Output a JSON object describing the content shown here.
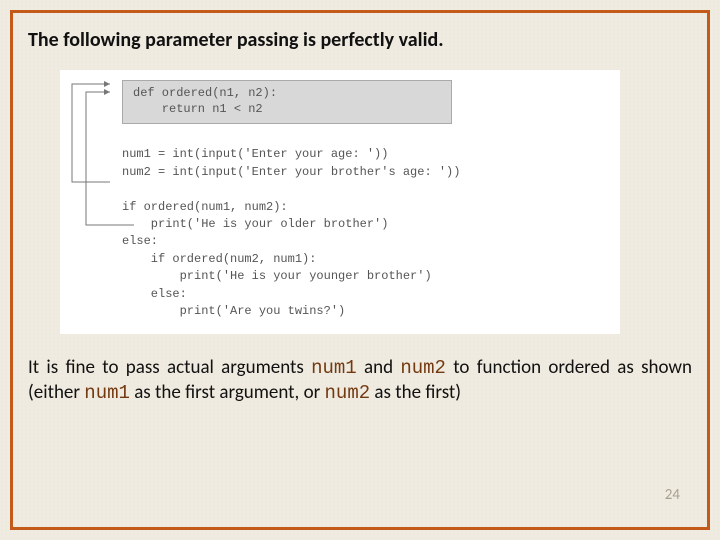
{
  "heading": "The following parameter passing is perfectly valid.",
  "code": {
    "fn_line1": "def ordered(n1, n2):",
    "fn_line2": "    return n1 < n2",
    "body": "num1 = int(input('Enter your age: '))\nnum2 = int(input('Enter your brother's age: '))\n\nif ordered(num1, num2):\n    print('He is your older brother')\nelse:\n    if ordered(num2, num1):\n        print('He is your younger brother')\n    else:\n        print('Are you twins?')"
  },
  "bodytext": {
    "t1": "It is fine to pass actual arguments ",
    "m1": "num1",
    "t2": " and ",
    "m2": "num2",
    "t3": " to function ordered as shown (either ",
    "m3": "num1",
    "t4": " as the first argument, or ",
    "m4": "num2",
    "t5": " as the first)"
  },
  "pagenum": "24"
}
